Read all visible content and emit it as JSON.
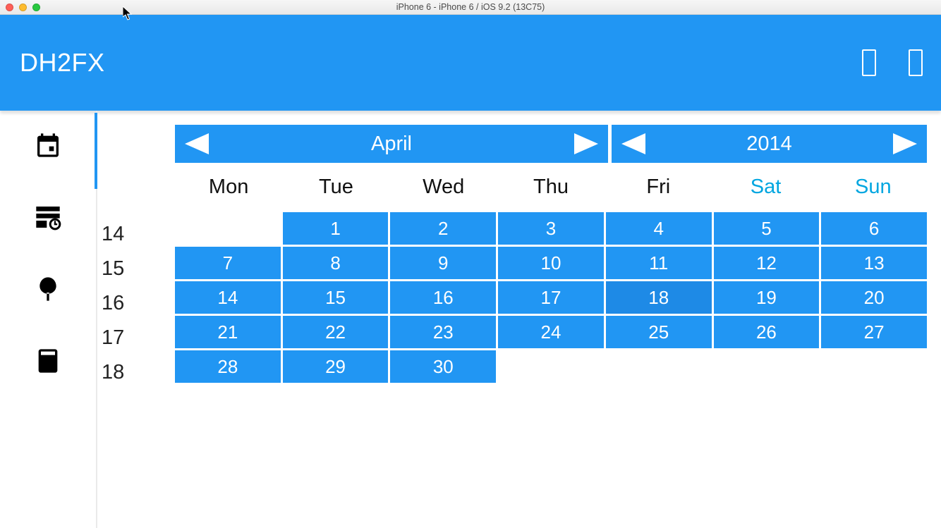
{
  "window": {
    "title": "iPhone 6 - iPhone 6 / iOS 9.2 (13C75)"
  },
  "header": {
    "title": "DH2FX"
  },
  "sidebar": {
    "items": [
      {
        "name": "calendar-icon"
      },
      {
        "name": "schedule-icon"
      },
      {
        "name": "tree-icon"
      },
      {
        "name": "calculator-icon"
      }
    ]
  },
  "calendar": {
    "month_label": "April",
    "year_label": "2014",
    "dow": [
      "Mon",
      "Tue",
      "Wed",
      "Thu",
      "Fri",
      "Sat",
      "Sun"
    ],
    "week_numbers": [
      "14",
      "15",
      "16",
      "17",
      "18"
    ],
    "selected_day": 18,
    "days": [
      null,
      1,
      2,
      3,
      4,
      5,
      6,
      7,
      8,
      9,
      10,
      11,
      12,
      13,
      14,
      15,
      16,
      17,
      18,
      19,
      20,
      21,
      22,
      23,
      24,
      25,
      26,
      27,
      28,
      29,
      30,
      null,
      null,
      null,
      null
    ]
  }
}
